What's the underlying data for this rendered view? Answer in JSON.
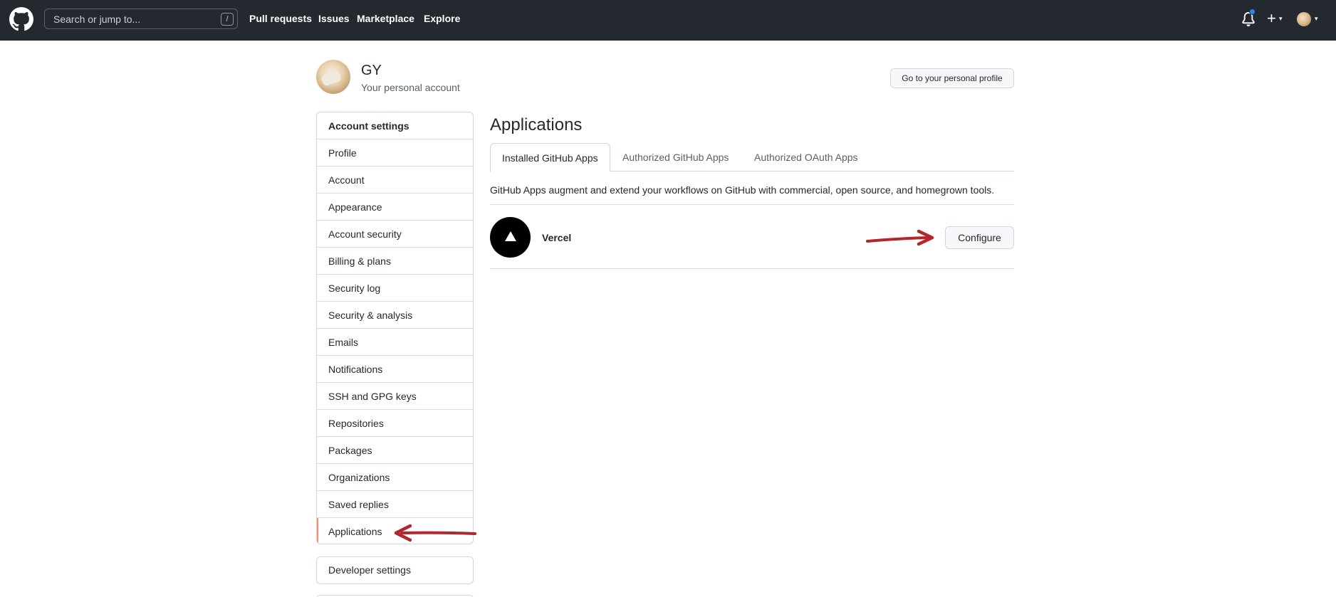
{
  "header": {
    "search_placeholder": "Search or jump to...",
    "search_shortcut": "/",
    "nav": [
      "Pull requests",
      "Issues",
      "Marketplace",
      "Explore"
    ],
    "plus_glyph": "+",
    "caret_glyph": "▾"
  },
  "user": {
    "name": "GY",
    "subtitle": "Your personal account",
    "profile_button": "Go to your personal profile"
  },
  "sidebar": {
    "heading": "Account settings",
    "items": [
      "Profile",
      "Account",
      "Appearance",
      "Account security",
      "Billing & plans",
      "Security log",
      "Security & analysis",
      "Emails",
      "Notifications",
      "SSH and GPG keys",
      "Repositories",
      "Packages",
      "Organizations",
      "Saved replies",
      "Applications"
    ],
    "active_item": "Applications",
    "developer_settings": "Developer settings"
  },
  "main": {
    "title": "Applications",
    "tabs": [
      "Installed GitHub Apps",
      "Authorized GitHub Apps",
      "Authorized OAuth Apps"
    ],
    "selected_tab": "Installed GitHub Apps",
    "description": "GitHub Apps augment and extend your workflows on GitHub with commercial, open source, and homegrown tools.",
    "apps": [
      {
        "name": "Vercel",
        "action": "Configure"
      }
    ]
  },
  "colors": {
    "header_bg": "#24292f",
    "accent_active": "#fd8c73",
    "notification_dot": "#2f81f7",
    "annotation_arrow": "#b3262b"
  },
  "icons": [
    "github-logo-icon",
    "bell-icon",
    "plus-icon",
    "chevron-down-icon",
    "vercel-triangle-icon"
  ]
}
